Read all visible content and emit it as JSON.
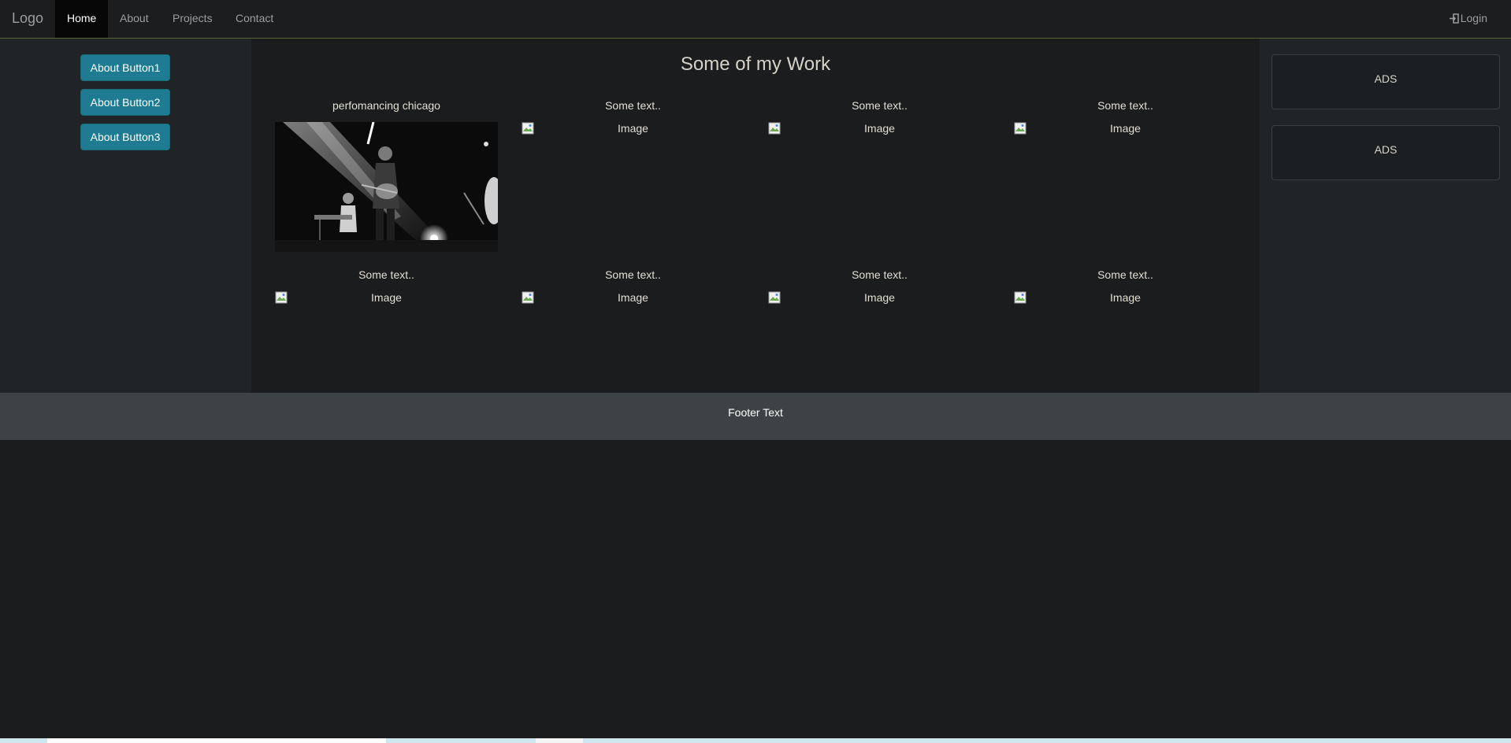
{
  "navbar": {
    "brand": "Logo",
    "items": [
      {
        "label": "Home",
        "active": true
      },
      {
        "label": "About",
        "active": false
      },
      {
        "label": "Projects",
        "active": false
      },
      {
        "label": "Contact",
        "active": false
      }
    ],
    "login_label": "Login",
    "login_icon": "login-icon"
  },
  "sidebar_left": {
    "buttons": [
      "About Button1",
      "About Button2",
      "About Button3"
    ]
  },
  "main": {
    "title": "Some of my Work",
    "grid": [
      {
        "caption": "perfomancing chicago",
        "image": "photo",
        "alt": ""
      },
      {
        "caption": "Some text..",
        "image": "broken",
        "alt": "Image"
      },
      {
        "caption": "Some text..",
        "image": "broken",
        "alt": "Image"
      },
      {
        "caption": "Some text..",
        "image": "broken",
        "alt": "Image"
      },
      {
        "caption": "Some text..",
        "image": "broken",
        "alt": "Image"
      },
      {
        "caption": "Some text..",
        "image": "broken",
        "alt": "Image"
      },
      {
        "caption": "Some text..",
        "image": "broken",
        "alt": "Image"
      },
      {
        "caption": "Some text..",
        "image": "broken",
        "alt": "Image"
      }
    ]
  },
  "sidebar_right": {
    "ads": [
      "ADS",
      "ADS"
    ]
  },
  "footer": {
    "text": "Footer Text"
  },
  "colors": {
    "accent_button": "#1e7b91",
    "navbar_border": "#5a6136",
    "footer_bg": "#3d4345"
  }
}
